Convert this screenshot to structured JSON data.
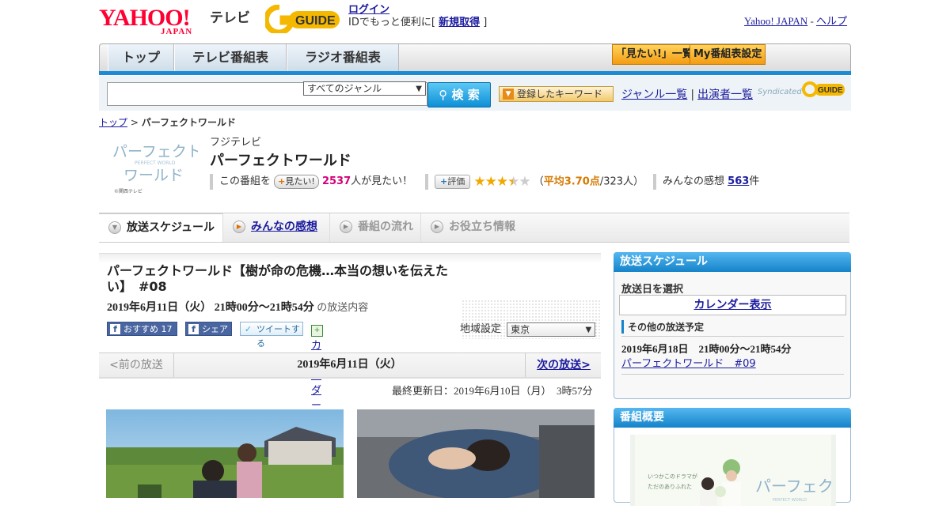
{
  "header": {
    "yahoo_logo": "YAHOO!",
    "yahoo_logo_sub": "JAPAN",
    "tv_label": "テレビ",
    "gguide_logo": "GUIDE",
    "login": "ログイン",
    "login_desc": "IDでもっと便利に[",
    "register": "新規取得",
    "login_close": "]",
    "yahoo_japan": "Yahoo! JAPAN",
    "sep": "-",
    "help": "ヘルプ"
  },
  "nav": {
    "tabs": [
      "トップ",
      "テレビ番組表",
      "ラジオ番組表"
    ],
    "mitai_list": "「見たい!」一覧",
    "my_schedule": "My番組表設定"
  },
  "search": {
    "genre": "すべてのジャンル",
    "search_btn": "検 索",
    "keyword_btn": "登録したキーワード",
    "genre_list": "ジャンル一覧",
    "pipe": "|",
    "cast_list": "出演者一覧",
    "syndicated": "Syndicated"
  },
  "breadcrumb": {
    "top": "トップ",
    "sep": ">",
    "current": "パーフェクトワールド"
  },
  "program": {
    "logo_text": "パーフェクト",
    "logo_sub": "PERFECT WORLD",
    "logo_text2": "ワールド",
    "logo_station": "©関西テレビ",
    "channel": "フジテレビ",
    "title": "パーフェクトワールド",
    "mitai_prefix": "この番組を",
    "mitai_btn": "見たい!",
    "mitai_count": "2537",
    "mitai_suffix": "人が見たい！",
    "hyoka_btn": "評価",
    "avg_open": "（",
    "avg_label": "平均3.70点",
    "avg_rest": "/323人）",
    "kanso_label": "みんなの感想",
    "kanso_count": "563",
    "kanso_suffix": "件",
    "rating": 3.7
  },
  "content_tabs": [
    "放送スケジュール",
    "みんなの感想",
    "番組の流れ",
    "お役立ち情報"
  ],
  "episode": {
    "title": "パーフェクトワールド【樹が命の危機…本当の想いを伝えたい】　#08",
    "date": "2019年6月11日（火）",
    "time": "21時00分～21時54分",
    "date_suffix": "の放送内容",
    "fb_recommend": "おすすめ 17",
    "fb_share": "シェア",
    "tweet": "ツイートする",
    "calendar_register": "カレンダーに登録",
    "region_label": "地域設定",
    "region_value": "東京"
  },
  "pager": {
    "prev": "<前の放送",
    "current": "2019年6月11日（火）",
    "next": "次の放送>"
  },
  "updated": "最終更新日：2019年6月10日（月）　3時57分",
  "sidebar": {
    "schedule_title": "放送スケジュール",
    "select_date": "放送日を選択",
    "calendar_btn": "カレンダー表示",
    "other_label": "その他の放送予定",
    "other_date": "2019年6月18日　21時00分～21時54分",
    "other_link": "パーフェクトワールド　#09",
    "overview_title": "番組概要",
    "overview_img_text1": "いつかこのドラマが",
    "overview_img_text2": "ただのありふれた",
    "overview_img_logo": "パーフェクト",
    "overview_img_logo_sub": "PERFECT WORLD"
  },
  "colors": {
    "accent_blue": "#1a8bd4",
    "yahoo_red": "#ff0033",
    "link": "#1b1b9e",
    "star": "#f0a800",
    "pink": "#d4007a"
  }
}
